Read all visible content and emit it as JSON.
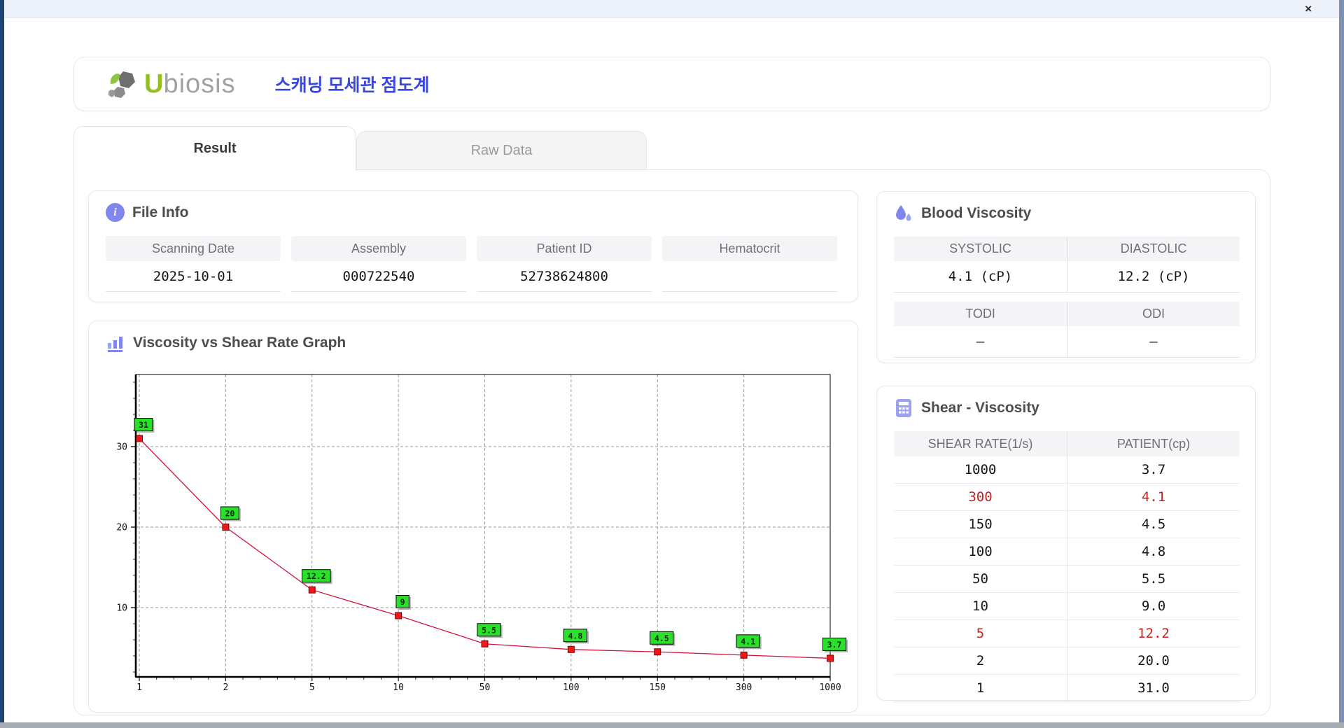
{
  "window": {
    "close_label": "×"
  },
  "header": {
    "logo_u": "U",
    "logo_rest": "biosis",
    "title": "스캐닝 모세관 점도계"
  },
  "tabs": [
    {
      "label": "Result",
      "active": true
    },
    {
      "label": "Raw Data",
      "active": false
    }
  ],
  "file_info": {
    "title": "File Info",
    "fields": [
      {
        "label": "Scanning Date",
        "value": "2025-10-01"
      },
      {
        "label": "Assembly",
        "value": "000722540"
      },
      {
        "label": "Patient ID",
        "value": "52738624800"
      },
      {
        "label": "Hematocrit",
        "value": ""
      }
    ]
  },
  "blood_viscosity": {
    "title": "Blood Viscosity",
    "groups": [
      [
        {
          "label": "SYSTOLIC",
          "value": "4.1 (cP)"
        },
        {
          "label": "DIASTOLIC",
          "value": "12.2 (cP)"
        }
      ],
      [
        {
          "label": "TODI",
          "value": "–"
        },
        {
          "label": "ODI",
          "value": "–"
        }
      ]
    ]
  },
  "graph": {
    "title": "Viscosity vs Shear Rate Graph"
  },
  "chart_data": {
    "type": "line",
    "title": "Viscosity vs Shear Rate Graph",
    "x_categories": [
      "1",
      "2",
      "5",
      "10",
      "50",
      "100",
      "150",
      "300",
      "1000"
    ],
    "values": [
      31,
      20,
      12.2,
      9,
      5.5,
      4.8,
      4.5,
      4.1,
      3.7
    ],
    "point_labels": [
      "31",
      "20",
      "12.2",
      "9",
      "5.5",
      "4.8",
      "4.5",
      "4.1",
      "3.7"
    ],
    "xlabel": "",
    "ylabel": "",
    "y_ticks": [
      10,
      20,
      30
    ],
    "y_minor_step": 2,
    "ylim": [
      1.4,
      39
    ],
    "x_scale": "categorical-equal-spacing",
    "grid": "dashed",
    "legend_position": "none",
    "line_color": "#d4103a",
    "marker_color": "#f01818",
    "marker_border": "#7a0000",
    "point_label_bg": "#2be02b",
    "point_label_border": "#000000"
  },
  "shear_table": {
    "title": "Shear - Viscosity",
    "columns": [
      "SHEAR RATE(1/s)",
      "PATIENT(cp)"
    ],
    "rows": [
      {
        "shear": "1000",
        "patient": "3.7",
        "highlight": false
      },
      {
        "shear": "300",
        "patient": "4.1",
        "highlight": true
      },
      {
        "shear": "150",
        "patient": "4.5",
        "highlight": false
      },
      {
        "shear": "100",
        "patient": "4.8",
        "highlight": false
      },
      {
        "shear": "50",
        "patient": "5.5",
        "highlight": false
      },
      {
        "shear": "10",
        "patient": "9.0",
        "highlight": false
      },
      {
        "shear": "5",
        "patient": "12.2",
        "highlight": true
      },
      {
        "shear": "2",
        "patient": "20.0",
        "highlight": false
      },
      {
        "shear": "1",
        "patient": "31.0",
        "highlight": false
      }
    ],
    "highlight_color": "#c62222"
  },
  "colors": {
    "accent_blue_violet": "#7f86ec",
    "title_korean_blue": "#3947e2",
    "logo_green": "#95c11f",
    "left_edge_navy": "#1d4472",
    "topbar": "#edf1f9"
  }
}
